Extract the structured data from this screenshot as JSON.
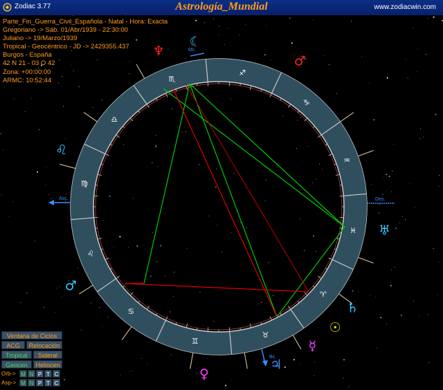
{
  "window": {
    "app_name": "Zodiac 3.77",
    "title": "Astrología_Mundial",
    "url": "www.zodiacwin.com"
  },
  "info_lines": [
    "Parte_Fin_Guerra_Civil_Española - Natal - Hora: Exacta",
    "Gregoriano -> Sáb. 01/Abr/1939 - 22:30:00",
    "Juliano -> 19/Marzo/1939",
    "Tropical - Geocéntrico - JD -> 2429355.437",
    "Burgos - España",
    "42 N 21 - 03 O 42",
    "Zona: +00:00:00",
    "ARMC: 10:52:44"
  ],
  "chart_labels": {
    "asc": "Asc.",
    "des": "Des.",
    "mc": "Mc.",
    "bc": "Bc."
  },
  "colors": {
    "ring": "#2f4f5f",
    "orange": "#ff9c20",
    "green_aspect": "#00cc00",
    "red_aspect": "#e00000",
    "blue": "#3a8cff",
    "cyan": "#30c8ff",
    "red_planet": "#ff2020",
    "yellow": "#e0e000",
    "magenta": "#ff40ff"
  },
  "panel": {
    "cycles": "Ventana de Ciclos",
    "acg": "ACG",
    "relocation": "Relocación",
    "tropical": "Tropical",
    "sidereal": "Sideral",
    "geocen": "Geocen",
    "heliocen": "Heliocen",
    "orb_label": "Orb->",
    "asp_label": "Asp->",
    "orb_buttons": [
      "M",
      "N",
      "P",
      "T",
      "C"
    ],
    "asp_buttons": [
      "M",
      "N",
      "P",
      "T",
      "C"
    ]
  },
  "zodiac_signs": [
    {
      "name": "aries",
      "glyph": "♈",
      "lon": 0
    },
    {
      "name": "taurus",
      "glyph": "♉",
      "lon": 30
    },
    {
      "name": "gemini",
      "glyph": "♊",
      "lon": 60
    },
    {
      "name": "cancer",
      "glyph": "♋",
      "lon": 90
    },
    {
      "name": "leo",
      "glyph": "♌",
      "lon": 120
    },
    {
      "name": "virgo",
      "glyph": "♍",
      "lon": 150
    },
    {
      "name": "libra",
      "glyph": "♎",
      "lon": 180
    },
    {
      "name": "scorpio",
      "glyph": "♏",
      "lon": 210
    },
    {
      "name": "sagittarius",
      "glyph": "♐",
      "lon": 240
    },
    {
      "name": "capricorn",
      "glyph": "♑",
      "lon": 270
    },
    {
      "name": "aquarius",
      "glyph": "♒",
      "lon": 300
    },
    {
      "name": "pisces",
      "glyph": "♓",
      "lon": 330
    }
  ],
  "planets": [
    {
      "name": "neptune",
      "glyph": "♆",
      "color": "#ff2020",
      "angle": -111
    },
    {
      "name": "moon",
      "glyph": "☾",
      "color": "#30c8ff",
      "angle": -98
    },
    {
      "name": "mars-2",
      "glyph": "♂",
      "color": "#ff2020",
      "angle": -61
    },
    {
      "name": "leo-planet",
      "glyph": "♌",
      "color": "#30c8ff",
      "angle": -160
    },
    {
      "name": "uranus",
      "glyph": "♅",
      "color": "#30c8ff",
      "angle": 8
    },
    {
      "name": "saturn",
      "glyph": "♄",
      "color": "#30c8ff",
      "angle": 37
    },
    {
      "name": "sun",
      "glyph": "☉",
      "color": "#e0e000",
      "angle": 46
    },
    {
      "name": "mercury",
      "glyph": "☿",
      "color": "#ff40ff",
      "angle": 56
    },
    {
      "name": "jupiter",
      "glyph": "♃",
      "color": "#3a8cff",
      "angle": 70
    },
    {
      "name": "venus",
      "glyph": "♀",
      "color": "#ff40ff",
      "angle": 95
    },
    {
      "name": "mars",
      "glyph": "♂",
      "color": "#30c8ff",
      "angle": 152
    }
  ]
}
